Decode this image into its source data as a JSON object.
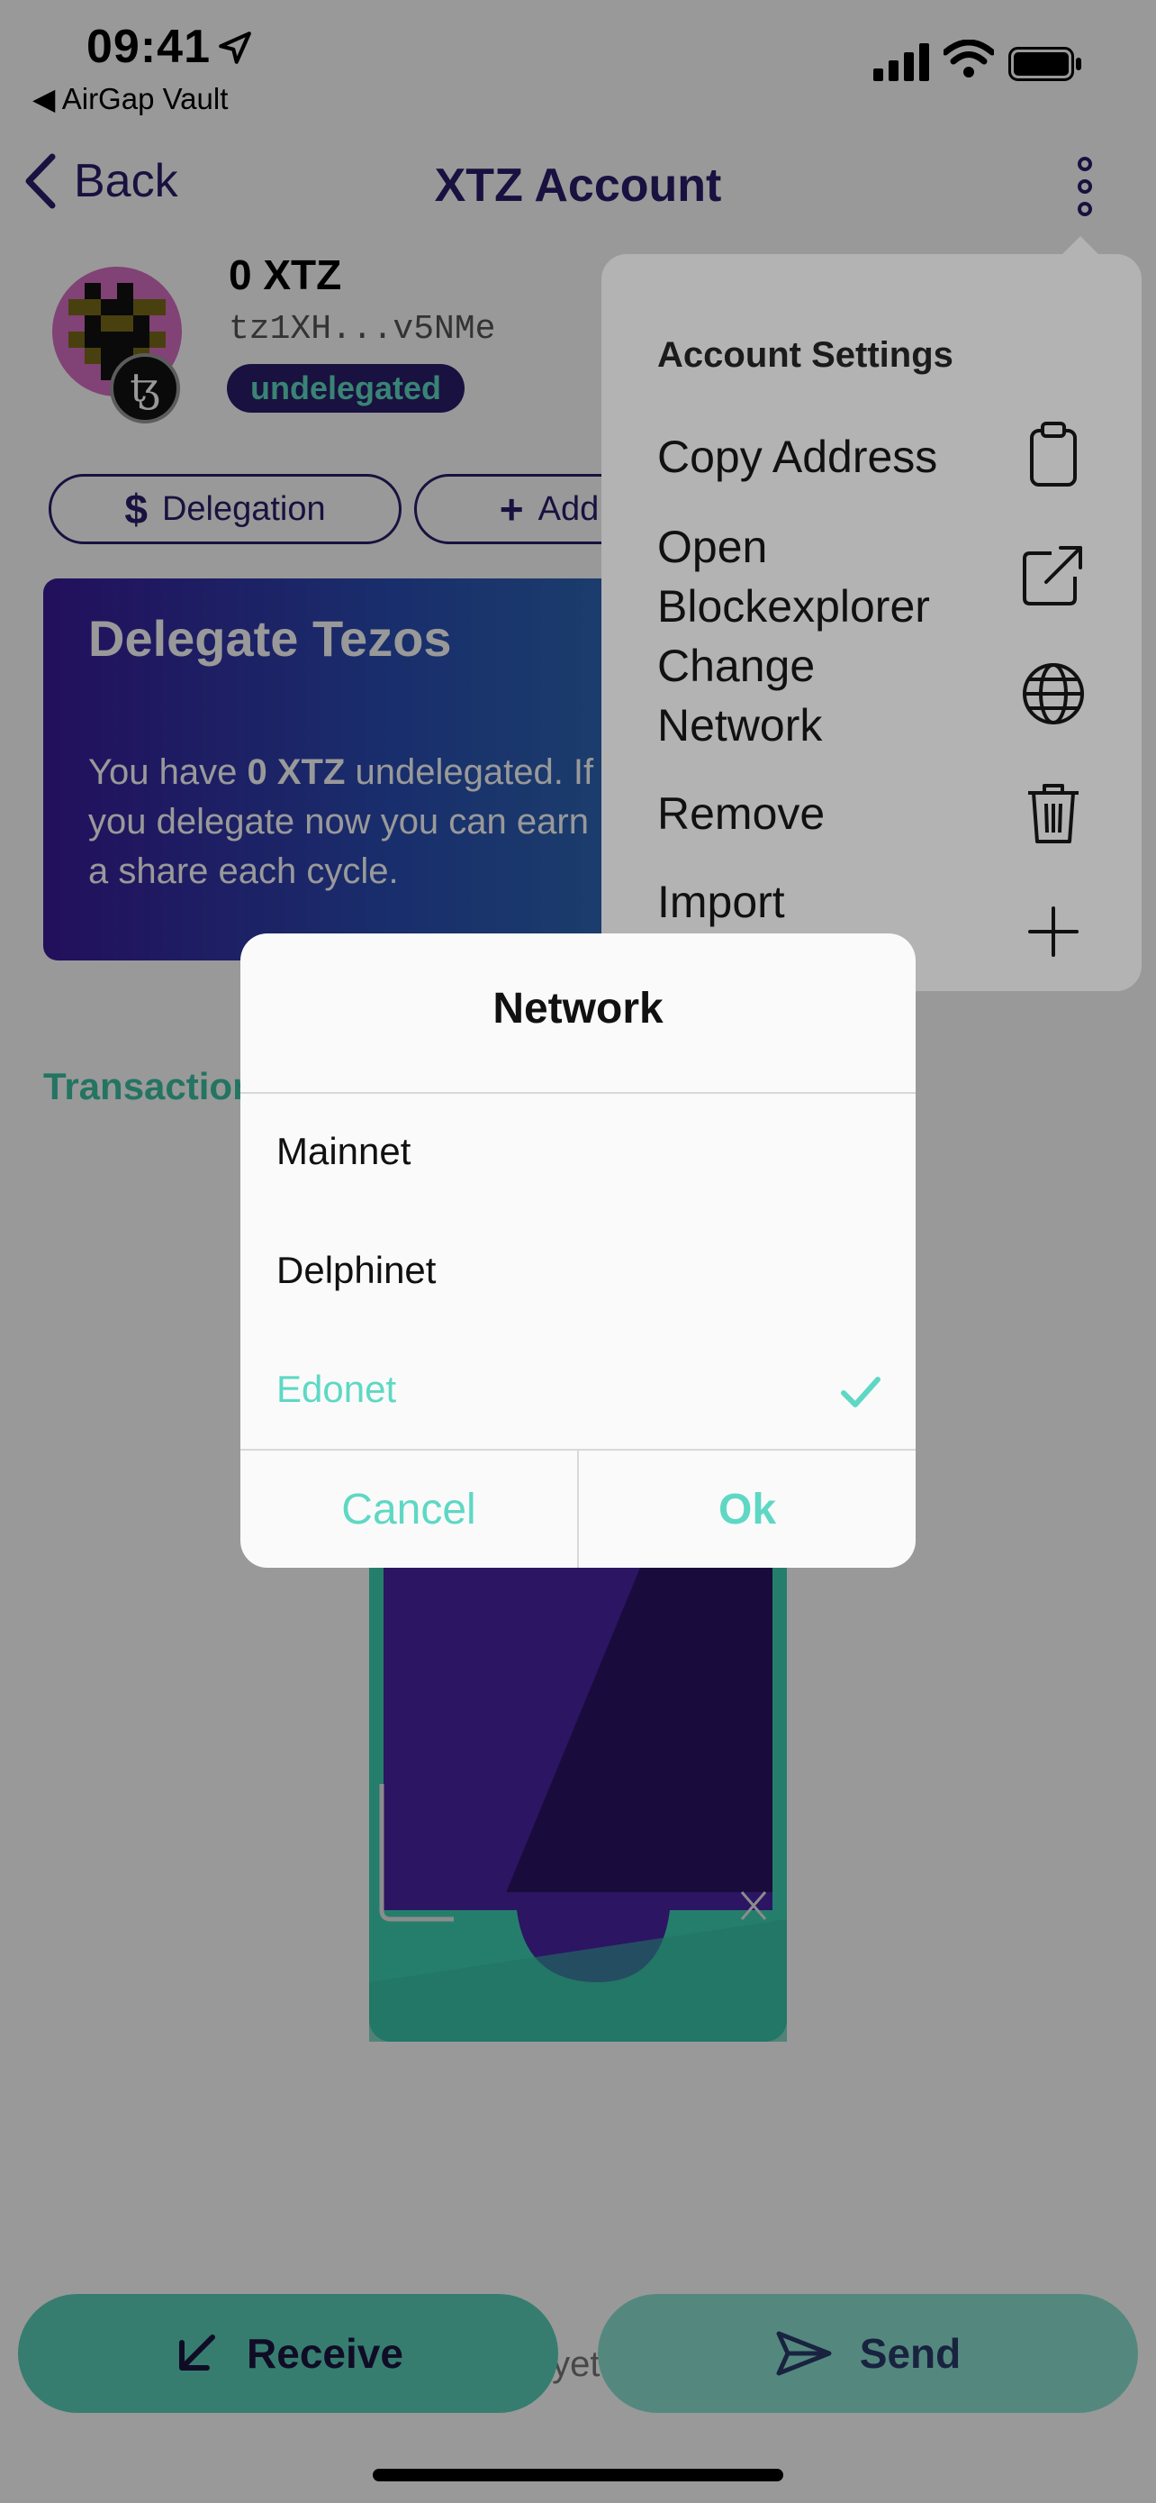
{
  "status_bar": {
    "time": "09:41",
    "back_app": "◀ AirGap Vault"
  },
  "nav": {
    "back_label": "Back",
    "title": "XTZ Account"
  },
  "account": {
    "balance": "0 XTZ",
    "address": "tz1XH...v5NMe",
    "status": "undelegated",
    "badge_glyph": "ꜩ"
  },
  "buttons": {
    "delegation": "Delegation",
    "delegation_icon": "$",
    "add": "Add",
    "add_icon": "+"
  },
  "delegate_card": {
    "title": "Delegate Tezos",
    "body_prefix": "You have ",
    "body_amount": "0 XTZ",
    "body_suffix": " undelegated. If you delegate now you can earn a share each cycle."
  },
  "transactions_label": "Transactions",
  "empty_text": "No transactions yet for this account.",
  "actions": {
    "receive": "Receive",
    "send": "Send"
  },
  "popover": {
    "header": "Account Settings",
    "items": [
      {
        "label": "Copy Address",
        "icon": "clipboard-icon"
      },
      {
        "label": "Open Blockexplorer",
        "icon": "external-link-icon"
      },
      {
        "label": "Change Network",
        "icon": "globe-icon"
      },
      {
        "label": "Remove",
        "icon": "trash-icon"
      },
      {
        "label": "Import",
        "icon": "plus-icon"
      }
    ]
  },
  "dialog": {
    "title": "Network",
    "options": [
      {
        "label": "Mainnet",
        "selected": false
      },
      {
        "label": "Delphinet",
        "selected": false
      },
      {
        "label": "Edonet",
        "selected": true
      }
    ],
    "cancel": "Cancel",
    "ok": "Ok"
  },
  "colors": {
    "brand": "#2b1d6a",
    "accent": "#5ed8c4",
    "overlay": "rgba(0,0,0,0.4)"
  }
}
